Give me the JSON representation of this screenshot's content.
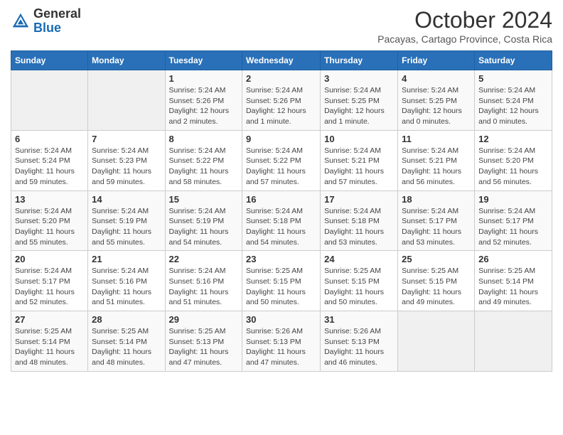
{
  "header": {
    "logo_general": "General",
    "logo_blue": "Blue",
    "month_title": "October 2024",
    "subtitle": "Pacayas, Cartago Province, Costa Rica"
  },
  "calendar": {
    "days_of_week": [
      "Sunday",
      "Monday",
      "Tuesday",
      "Wednesday",
      "Thursday",
      "Friday",
      "Saturday"
    ],
    "weeks": [
      [
        {
          "day": "",
          "detail": ""
        },
        {
          "day": "",
          "detail": ""
        },
        {
          "day": "1",
          "detail": "Sunrise: 5:24 AM\nSunset: 5:26 PM\nDaylight: 12 hours\nand 2 minutes."
        },
        {
          "day": "2",
          "detail": "Sunrise: 5:24 AM\nSunset: 5:26 PM\nDaylight: 12 hours\nand 1 minute."
        },
        {
          "day": "3",
          "detail": "Sunrise: 5:24 AM\nSunset: 5:25 PM\nDaylight: 12 hours\nand 1 minute."
        },
        {
          "day": "4",
          "detail": "Sunrise: 5:24 AM\nSunset: 5:25 PM\nDaylight: 12 hours\nand 0 minutes."
        },
        {
          "day": "5",
          "detail": "Sunrise: 5:24 AM\nSunset: 5:24 PM\nDaylight: 12 hours\nand 0 minutes."
        }
      ],
      [
        {
          "day": "6",
          "detail": "Sunrise: 5:24 AM\nSunset: 5:24 PM\nDaylight: 11 hours\nand 59 minutes."
        },
        {
          "day": "7",
          "detail": "Sunrise: 5:24 AM\nSunset: 5:23 PM\nDaylight: 11 hours\nand 59 minutes."
        },
        {
          "day": "8",
          "detail": "Sunrise: 5:24 AM\nSunset: 5:22 PM\nDaylight: 11 hours\nand 58 minutes."
        },
        {
          "day": "9",
          "detail": "Sunrise: 5:24 AM\nSunset: 5:22 PM\nDaylight: 11 hours\nand 57 minutes."
        },
        {
          "day": "10",
          "detail": "Sunrise: 5:24 AM\nSunset: 5:21 PM\nDaylight: 11 hours\nand 57 minutes."
        },
        {
          "day": "11",
          "detail": "Sunrise: 5:24 AM\nSunset: 5:21 PM\nDaylight: 11 hours\nand 56 minutes."
        },
        {
          "day": "12",
          "detail": "Sunrise: 5:24 AM\nSunset: 5:20 PM\nDaylight: 11 hours\nand 56 minutes."
        }
      ],
      [
        {
          "day": "13",
          "detail": "Sunrise: 5:24 AM\nSunset: 5:20 PM\nDaylight: 11 hours\nand 55 minutes."
        },
        {
          "day": "14",
          "detail": "Sunrise: 5:24 AM\nSunset: 5:19 PM\nDaylight: 11 hours\nand 55 minutes."
        },
        {
          "day": "15",
          "detail": "Sunrise: 5:24 AM\nSunset: 5:19 PM\nDaylight: 11 hours\nand 54 minutes."
        },
        {
          "day": "16",
          "detail": "Sunrise: 5:24 AM\nSunset: 5:18 PM\nDaylight: 11 hours\nand 54 minutes."
        },
        {
          "day": "17",
          "detail": "Sunrise: 5:24 AM\nSunset: 5:18 PM\nDaylight: 11 hours\nand 53 minutes."
        },
        {
          "day": "18",
          "detail": "Sunrise: 5:24 AM\nSunset: 5:17 PM\nDaylight: 11 hours\nand 53 minutes."
        },
        {
          "day": "19",
          "detail": "Sunrise: 5:24 AM\nSunset: 5:17 PM\nDaylight: 11 hours\nand 52 minutes."
        }
      ],
      [
        {
          "day": "20",
          "detail": "Sunrise: 5:24 AM\nSunset: 5:17 PM\nDaylight: 11 hours\nand 52 minutes."
        },
        {
          "day": "21",
          "detail": "Sunrise: 5:24 AM\nSunset: 5:16 PM\nDaylight: 11 hours\nand 51 minutes."
        },
        {
          "day": "22",
          "detail": "Sunrise: 5:24 AM\nSunset: 5:16 PM\nDaylight: 11 hours\nand 51 minutes."
        },
        {
          "day": "23",
          "detail": "Sunrise: 5:25 AM\nSunset: 5:15 PM\nDaylight: 11 hours\nand 50 minutes."
        },
        {
          "day": "24",
          "detail": "Sunrise: 5:25 AM\nSunset: 5:15 PM\nDaylight: 11 hours\nand 50 minutes."
        },
        {
          "day": "25",
          "detail": "Sunrise: 5:25 AM\nSunset: 5:15 PM\nDaylight: 11 hours\nand 49 minutes."
        },
        {
          "day": "26",
          "detail": "Sunrise: 5:25 AM\nSunset: 5:14 PM\nDaylight: 11 hours\nand 49 minutes."
        }
      ],
      [
        {
          "day": "27",
          "detail": "Sunrise: 5:25 AM\nSunset: 5:14 PM\nDaylight: 11 hours\nand 48 minutes."
        },
        {
          "day": "28",
          "detail": "Sunrise: 5:25 AM\nSunset: 5:14 PM\nDaylight: 11 hours\nand 48 minutes."
        },
        {
          "day": "29",
          "detail": "Sunrise: 5:25 AM\nSunset: 5:13 PM\nDaylight: 11 hours\nand 47 minutes."
        },
        {
          "day": "30",
          "detail": "Sunrise: 5:26 AM\nSunset: 5:13 PM\nDaylight: 11 hours\nand 47 minutes."
        },
        {
          "day": "31",
          "detail": "Sunrise: 5:26 AM\nSunset: 5:13 PM\nDaylight: 11 hours\nand 46 minutes."
        },
        {
          "day": "",
          "detail": ""
        },
        {
          "day": "",
          "detail": ""
        }
      ]
    ]
  }
}
